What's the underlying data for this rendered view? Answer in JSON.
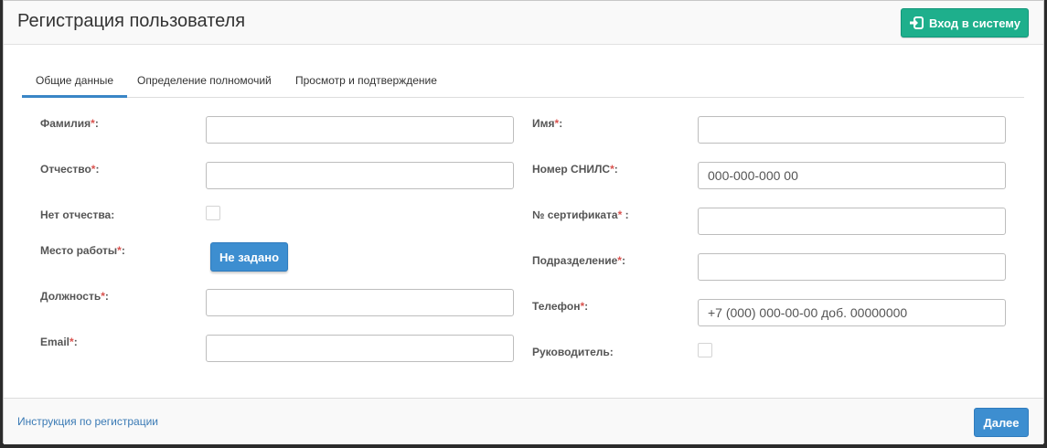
{
  "header": {
    "title": "Регистрация пользователя",
    "login_button": "Вход в систему",
    "login_icon": "sign-in-icon"
  },
  "tabs": [
    {
      "label": "Общие данные",
      "active": true
    },
    {
      "label": "Определение полномочий",
      "active": false
    },
    {
      "label": "Просмотр и подтверждение",
      "active": false
    }
  ],
  "form": {
    "required_mark": "*",
    "left": {
      "last_name": {
        "label": "Фамилия",
        "value": ""
      },
      "patronymic": {
        "label": "Отчество",
        "value": ""
      },
      "no_patronymic": {
        "label": "Нет отчества:",
        "checked": false
      },
      "workplace": {
        "label": "Место работы",
        "button": "Не задано"
      },
      "position": {
        "label": "Должность",
        "value": ""
      },
      "email": {
        "label": "Email",
        "value": ""
      }
    },
    "right": {
      "first_name": {
        "label": "Имя",
        "value": ""
      },
      "snils": {
        "label": "Номер СНИЛС",
        "placeholder": "000-000-000 00"
      },
      "certificate": {
        "label": "№ сертификата",
        "suffix": " :",
        "value": ""
      },
      "department": {
        "label": "Подразделение",
        "value": ""
      },
      "phone": {
        "label": "Телефон",
        "placeholder": "+7 (000) 000-00-00 доб. 00000000"
      },
      "manager": {
        "label": "Руководитель:",
        "checked": false
      }
    },
    "colon": ":"
  },
  "footer": {
    "instructions_link": "Инструкция по регистрации",
    "next_button": "Далее"
  },
  "colors": {
    "accent_green": "#1eaf8c",
    "primary_blue": "#3d8ed0",
    "required_red": "#d9534f"
  }
}
